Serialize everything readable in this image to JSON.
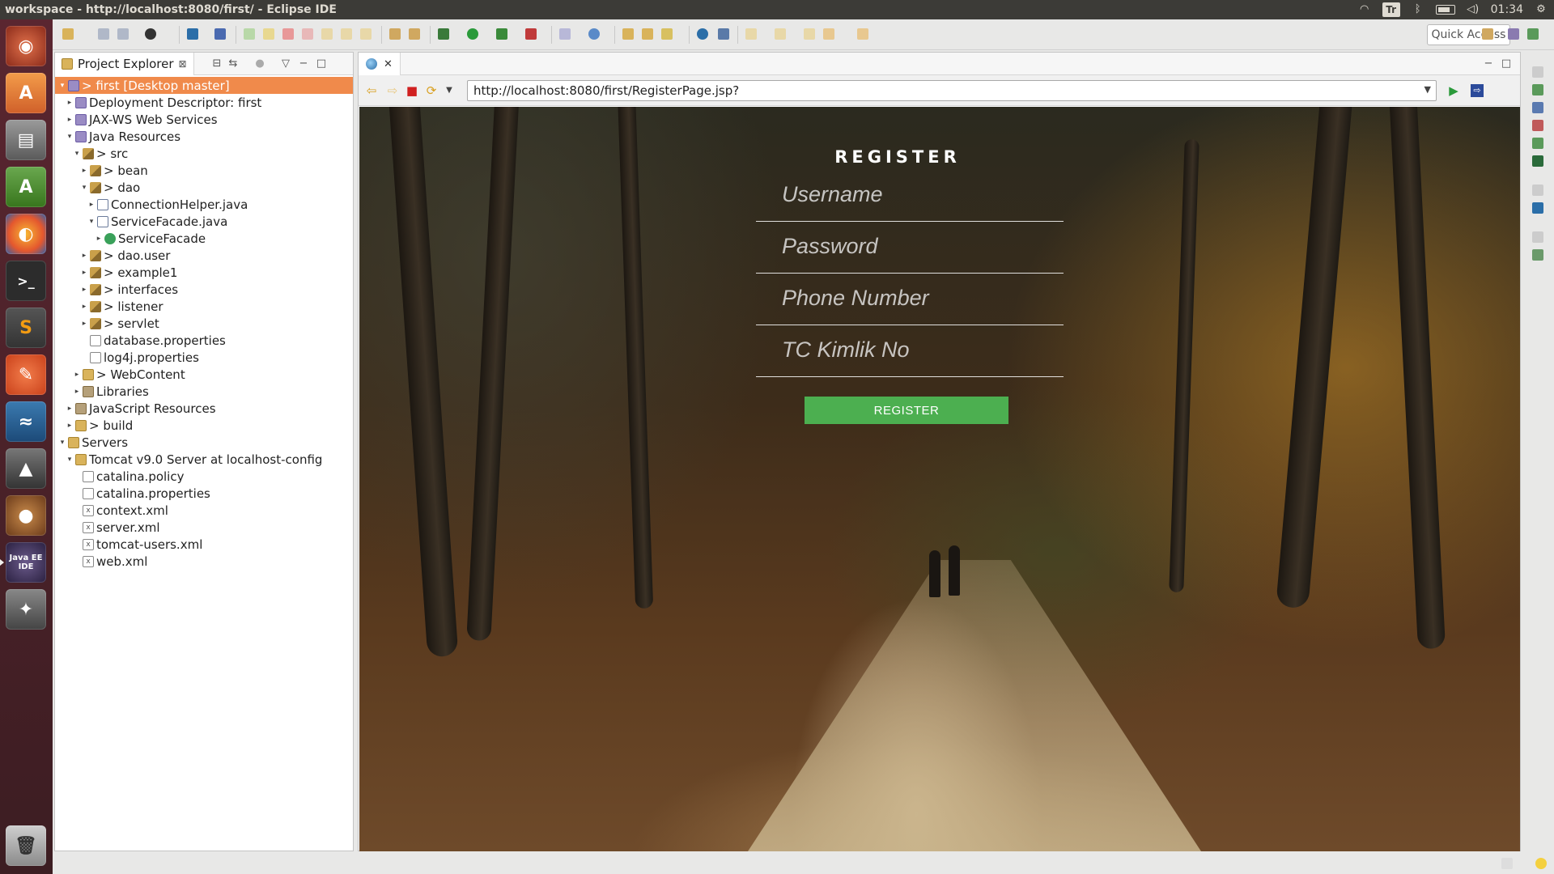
{
  "window": {
    "title": "workspace - http://localhost:8080/first/ - Eclipse IDE"
  },
  "tray": {
    "keyboard": "Tr",
    "clock": "01:34"
  },
  "launcher": {
    "items": [
      "dash-icon",
      "software-center-icon",
      "files-icon",
      "android-studio-icon",
      "firefox-icon",
      "terminal-icon",
      "sublime-text-icon",
      "editor-icon",
      "mysql-workbench-icon",
      "kaffeine-icon",
      "acorn-icon",
      "java-ee-ide-icon",
      "gimp-icon",
      "trash-icon"
    ],
    "java_ee_label": "Java EE IDE"
  },
  "toolbar": {
    "quick_access": "Quick Access"
  },
  "explorer": {
    "tab_label": "Project Explorer",
    "tree": [
      {
        "label": "> first [Desktop master]",
        "indent": 0,
        "twisty": "▾",
        "icon": "proj",
        "selected": true
      },
      {
        "label": "Deployment Descriptor: first",
        "indent": 1,
        "twisty": "▸",
        "icon": "proj"
      },
      {
        "label": "JAX-WS Web Services",
        "indent": 1,
        "twisty": "▸",
        "icon": "proj"
      },
      {
        "label": "Java Resources",
        "indent": 1,
        "twisty": "▾",
        "icon": "proj"
      },
      {
        "label": "> src",
        "indent": 2,
        "twisty": "▾",
        "icon": "pkg"
      },
      {
        "label": "> bean",
        "indent": 3,
        "twisty": "▸",
        "icon": "pkg"
      },
      {
        "label": "> dao",
        "indent": 3,
        "twisty": "▾",
        "icon": "pkg"
      },
      {
        "label": "ConnectionHelper.java",
        "indent": 4,
        "twisty": "▸",
        "icon": "java"
      },
      {
        "label": "ServiceFacade.java",
        "indent": 4,
        "twisty": "▾",
        "icon": "java"
      },
      {
        "label": "ServiceFacade",
        "indent": 5,
        "twisty": "▸",
        "icon": "class"
      },
      {
        "label": "> dao.user",
        "indent": 3,
        "twisty": "▸",
        "icon": "pkg"
      },
      {
        "label": "> example1",
        "indent": 3,
        "twisty": "▸",
        "icon": "pkg"
      },
      {
        "label": "> interfaces",
        "indent": 3,
        "twisty": "▸",
        "icon": "pkg"
      },
      {
        "label": "> listener",
        "indent": 3,
        "twisty": "▸",
        "icon": "pkg"
      },
      {
        "label": "> servlet",
        "indent": 3,
        "twisty": "▸",
        "icon": "pkg"
      },
      {
        "label": "database.properties",
        "indent": 3,
        "twisty": "",
        "icon": "file"
      },
      {
        "label": "log4j.properties",
        "indent": 3,
        "twisty": "",
        "icon": "file"
      },
      {
        "label": "> WebContent",
        "indent": 2,
        "twisty": "▸",
        "icon": "folder"
      },
      {
        "label": "Libraries",
        "indent": 2,
        "twisty": "▸",
        "icon": "lib"
      },
      {
        "label": "JavaScript Resources",
        "indent": 1,
        "twisty": "▸",
        "icon": "lib"
      },
      {
        "label": "> build",
        "indent": 1,
        "twisty": "▸",
        "icon": "folder"
      },
      {
        "label": "Servers",
        "indent": 0,
        "twisty": "▾",
        "icon": "server"
      },
      {
        "label": "Tomcat v9.0 Server at localhost-config",
        "indent": 1,
        "twisty": "▾",
        "icon": "folder"
      },
      {
        "label": "catalina.policy",
        "indent": 2,
        "twisty": "",
        "icon": "file"
      },
      {
        "label": "catalina.properties",
        "indent": 2,
        "twisty": "",
        "icon": "file"
      },
      {
        "label": "context.xml",
        "indent": 2,
        "twisty": "",
        "icon": "xml"
      },
      {
        "label": "server.xml",
        "indent": 2,
        "twisty": "",
        "icon": "xml"
      },
      {
        "label": "tomcat-users.xml",
        "indent": 2,
        "twisty": "",
        "icon": "xml"
      },
      {
        "label": "web.xml",
        "indent": 2,
        "twisty": "",
        "icon": "xml"
      }
    ]
  },
  "browser": {
    "url": "http://localhost:8080/first/RegisterPage.jsp?"
  },
  "register": {
    "title": "REGISTER",
    "username_placeholder": "Username",
    "password_placeholder": "Password",
    "phone_placeholder": "Phone Number",
    "tc_placeholder": "TC Kimlik No",
    "button_label": "REGISTER"
  },
  "colors": {
    "selection": "#f08a4b",
    "register_button": "#4caf50",
    "launcher_bg": "#5a2630",
    "topbar_bg": "#3c3b37"
  }
}
